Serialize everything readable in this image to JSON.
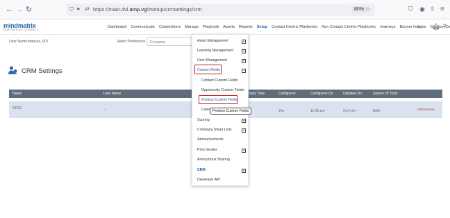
{
  "browser": {
    "back": "←",
    "forward": "→",
    "reload": "↻",
    "url_prefix": "https://main.dvl.",
    "url_host": "amp.vg",
    "url_path": "/#setup/crmsettings/crm",
    "zoom": "80%"
  },
  "app": {
    "logo": "mindmatrix",
    "logo_sub": "EMPOWERING CHANNELS",
    "nav": [
      "Dashboard",
      "Communicate",
      "Connections",
      "Manage",
      "Playbook",
      "Assets",
      "Reports",
      "Setup",
      "Contact Centric Playbooks",
      "Non Contact Centric Playbooks",
      "Journeys",
      "Banner Images",
      "Solution Center"
    ]
  },
  "filters": {
    "user_name_label": "User Name :",
    "user_name_value": "Imteyaz_007",
    "preference_label": "Select Preference :",
    "preference_value": "Company"
  },
  "page": {
    "title": "CRM Settings"
  },
  "table": {
    "headers": [
      "Name",
      "User Name",
      "Sync Time",
      "Configured",
      "Configured On",
      "Updated On",
      "Source Of Truth"
    ],
    "row": {
      "name": "SFDC",
      "user_name": "--",
      "configured": "Yes",
      "configured_on": "11:06 am",
      "updated_on": "9:14 pm",
      "source": "Both",
      "action": "Deactivate"
    }
  },
  "menu": {
    "items": [
      {
        "label": "Asset Management",
        "expandable": true
      },
      {
        "label": "Learning Management",
        "expandable": true
      },
      {
        "label": "User Management",
        "expandable": true
      },
      {
        "label": "Custom Fields",
        "expandable": true,
        "open": true
      },
      {
        "label": "Contact Custom Fields",
        "sub": true
      },
      {
        "label": "Opportunity Custom Fields",
        "sub": true
      },
      {
        "label": "Product Custom Fields",
        "sub": true,
        "highlighted": true
      },
      {
        "label": "Case",
        "sub": true
      },
      {
        "label": "Scoring",
        "expandable": true
      },
      {
        "label": "Company Smart Lists",
        "expandable": true
      },
      {
        "label": "Announcements"
      },
      {
        "label": "Print Vendor",
        "expandable": true
      },
      {
        "label": "Anonymous Sharing"
      },
      {
        "label": "CRM",
        "expandable": true
      },
      {
        "label": "Developer API"
      }
    ],
    "plus": "+",
    "minus": "−"
  },
  "tooltip": "Product Custom Fields",
  "colors": {
    "accent": "#1a5fa8",
    "highlight": "#cc1b1b",
    "table_header": "#5f6d7a",
    "row_bg": "#d9e2ee"
  }
}
